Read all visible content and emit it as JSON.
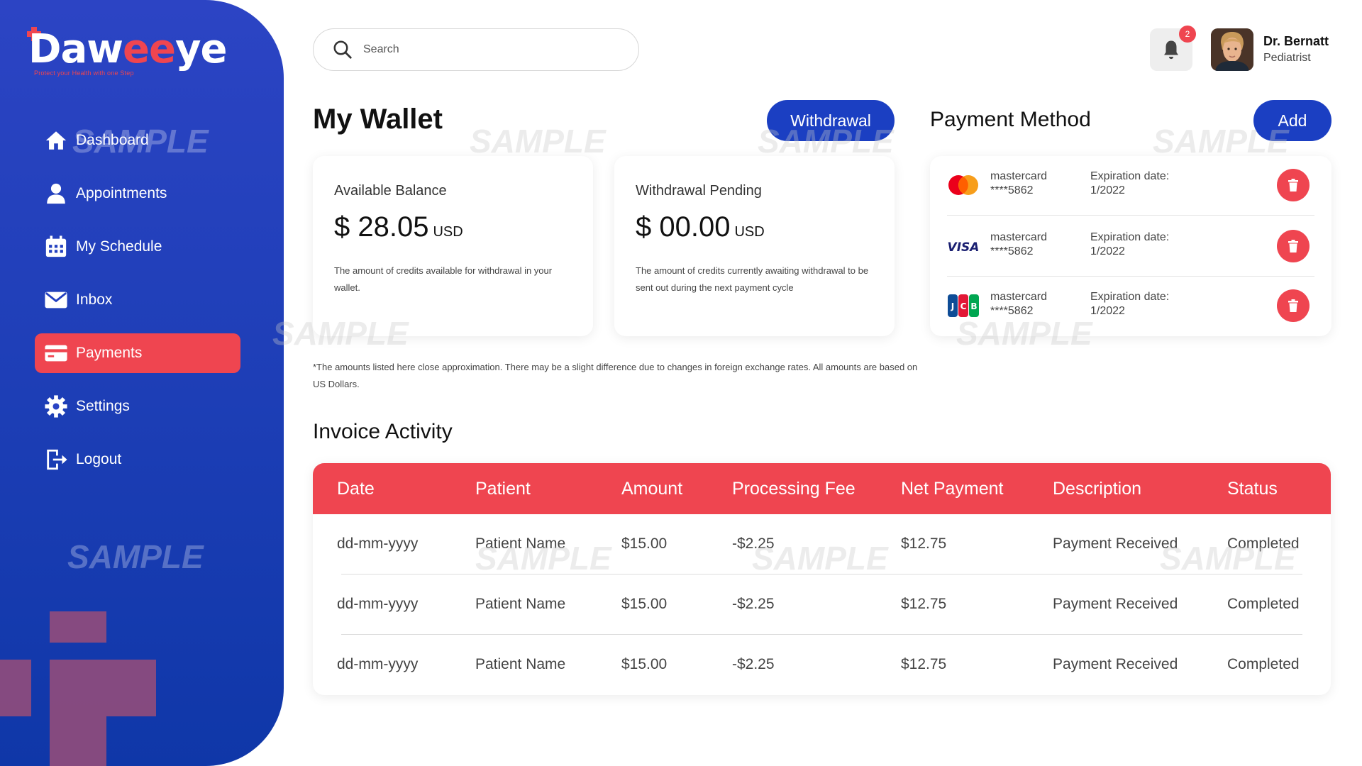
{
  "brand": {
    "logo_white": "Daw",
    "logo_red": "ee",
    "logo_white2": "ye",
    "tagline": "Protect your Health with one Step"
  },
  "sidebar": {
    "items": [
      {
        "label": "Dashboard",
        "icon": "home-icon",
        "active": false
      },
      {
        "label": "Appointments",
        "icon": "user-icon",
        "active": false
      },
      {
        "label": "My Schedule",
        "icon": "calendar-icon",
        "active": false
      },
      {
        "label": "Inbox",
        "icon": "mail-icon",
        "active": false
      },
      {
        "label": "Payments",
        "icon": "card-icon",
        "active": true
      },
      {
        "label": "Settings",
        "icon": "gear-icon",
        "active": false
      },
      {
        "label": "Logout",
        "icon": "logout-icon",
        "active": false
      }
    ]
  },
  "header": {
    "search_placeholder": "Search",
    "notification_count": "2",
    "user_name": "Dr. Bernatt",
    "user_role": "Pediatrist"
  },
  "wallet": {
    "title": "My Wallet",
    "withdrawal_label": "Withdrawal",
    "available": {
      "label": "Available Balance",
      "amount": "$ 28.05",
      "unit": "USD",
      "desc": "The amount of credits available for withdrawal in your wallet."
    },
    "pending": {
      "label": "Withdrawal Pending",
      "amount": "$ 00.00",
      "unit": "USD",
      "desc": "The amount of credits currently awaiting withdrawal to be sent out during the next payment cycle"
    },
    "disclaimer": "*The amounts listed here close approximation. There may be a slight difference due to changes in foreign exchange rates. All amounts are based on US Dollars."
  },
  "payment_method": {
    "title": "Payment Method",
    "add_label": "Add",
    "cards": [
      {
        "brand": "mastercard",
        "logo": "mastercard-icon",
        "name": "mastercard",
        "number": "****5862",
        "exp_label": "Expiration date:",
        "exp_value": "1/2022"
      },
      {
        "brand": "visa",
        "logo": "visa-icon",
        "name": "mastercard",
        "number": "****5862",
        "exp_label": "Expiration date:",
        "exp_value": "1/2022"
      },
      {
        "brand": "jcb",
        "logo": "jcb-icon",
        "name": "mastercard",
        "number": "****5862",
        "exp_label": "Expiration date:",
        "exp_value": "1/2022"
      }
    ]
  },
  "invoice": {
    "title": "Invoice Activity",
    "headers": [
      "Date",
      "Patient",
      "Amount",
      "Processing Fee",
      "Net Payment",
      "Description",
      "Status"
    ],
    "rows": [
      [
        "dd-mm-yyyy",
        "Patient Name",
        "$15.00",
        "-$2.25",
        "$12.75",
        "Payment Received",
        "Completed"
      ],
      [
        "dd-mm-yyyy",
        "Patient Name",
        "$15.00",
        "-$2.25",
        "$12.75",
        "Payment Received",
        "Completed"
      ],
      [
        "dd-mm-yyyy",
        "Patient Name",
        "$15.00",
        "-$2.25",
        "$12.75",
        "Payment Received",
        "Completed"
      ]
    ]
  },
  "watermark": "SAMPLE",
  "colors": {
    "primary_blue": "#1b3fc2",
    "accent_red": "#ef4550"
  }
}
